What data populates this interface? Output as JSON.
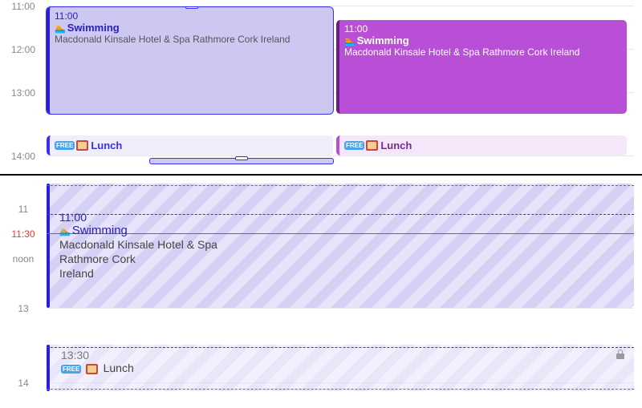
{
  "top": {
    "times": {
      "t11": "11:00",
      "t12": "12:00",
      "t13": "13:00",
      "t14": "14:00"
    },
    "events": {
      "swimLeft": {
        "time": "11:00",
        "title": "Swimming",
        "loc": "Macdonald Kinsale Hotel & Spa Rathmore Cork Ireland"
      },
      "swimRight": {
        "time": "11:00",
        "title": "Swimming",
        "loc": "Macdonald Kinsale Hotel & Spa Rathmore Cork Ireland"
      },
      "lunchLeft": {
        "title": "Lunch",
        "badge": "FREE"
      },
      "lunchRight": {
        "title": "Lunch",
        "badge": "FREE"
      }
    }
  },
  "bottom": {
    "times": {
      "t11": "11",
      "t1130": "11:30",
      "tnoon": "noon",
      "t13": "13",
      "t14": "14"
    },
    "events": {
      "swim": {
        "time": "11:00",
        "title": "Swimming",
        "loc1": "Macdonald Kinsale Hotel & Spa",
        "loc2": "Rathmore Cork",
        "loc3": "Ireland"
      },
      "lunch": {
        "time": "13:30",
        "title": "Lunch",
        "badge": "FREE"
      }
    }
  }
}
